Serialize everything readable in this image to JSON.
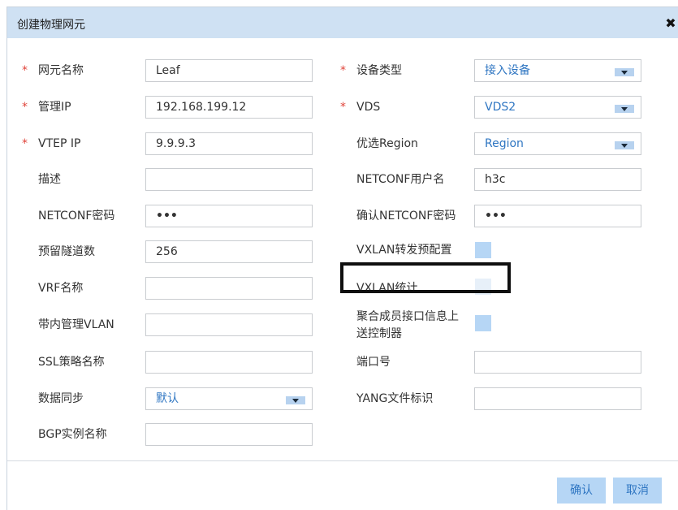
{
  "dialog": {
    "title": "创建物理网元",
    "close_label": "✖",
    "confirm_label": "确认",
    "cancel_label": "取消"
  },
  "left_fields": [
    {
      "label": "网元名称",
      "value": "Leaf",
      "required": true
    },
    {
      "label": "管理IP",
      "value": "192.168.199.12",
      "required": true
    },
    {
      "label": "VTEP IP",
      "value": "9.9.9.3",
      "required": true
    },
    {
      "label": "描述",
      "value": ""
    },
    {
      "label": "NETCONF密码",
      "value": "•••"
    },
    {
      "label": "预留隧道数",
      "value": "256"
    },
    {
      "label": "VRF名称",
      "value": ""
    },
    {
      "label": "带内管理VLAN",
      "value": ""
    },
    {
      "label": "SSL策略名称",
      "value": ""
    },
    {
      "label": "数据同步",
      "value": "默认"
    },
    {
      "label": "BGP实例名称",
      "value": ""
    }
  ],
  "right_fields": [
    {
      "label": "设备类型",
      "value": "接入设备",
      "required": true
    },
    {
      "label": "VDS",
      "value": "VDS2",
      "required": true
    },
    {
      "label": "优选Region",
      "value": "Region"
    },
    {
      "label": "NETCONF用户名",
      "value": "h3c"
    },
    {
      "label": "确认NETCONF密码",
      "value": "•••"
    },
    {
      "label": "VXLAN转发预配置"
    },
    {
      "label": "VXLAN统计"
    },
    {
      "label_line1": "聚合成员接口信息上",
      "label_line2": "送控制器"
    },
    {
      "label": "端口号",
      "value": ""
    },
    {
      "label": "YANG文件标识",
      "value": ""
    }
  ],
  "colors": {
    "title_bg": "#cfe1f3",
    "accent_text": "#2f76c2",
    "required_star": "#e0443a",
    "button_bg": "#b6d6f5"
  }
}
